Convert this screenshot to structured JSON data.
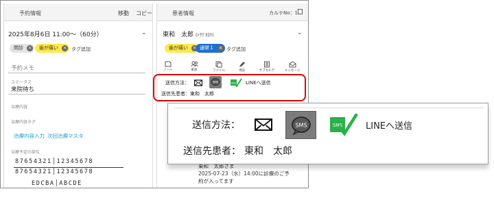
{
  "left_panel": {
    "title": "予約情報",
    "move_label": "移動",
    "copy_label": "コピー",
    "datetime": "2025年8月6日 11:00～（60分）",
    "tags": [
      "問診",
      "歯が痛い"
    ],
    "add_tag": "タグ追加",
    "memo_placeholder": "予約メモ",
    "status_label": "ステータス",
    "status_value": "来院待ち",
    "treatment_label": "治療内容",
    "treatment_tag_label": "治療内容タグ",
    "treatment_input_link": "治療内容入力",
    "next_master_link": "次回治療マスタ",
    "planned_site_label": "治療予定の部位",
    "tooth_upper": "87654321│12345678",
    "tooth_lower": "87654321│12345678",
    "tooth_letters": "EDCBA│ABCDE"
  },
  "right_panel": {
    "title": "患者情報",
    "karte_no": "カルテNo：1",
    "patient_name": "東和　太郎",
    "patient_kana": "(ﾄｳﾜ ﾀﾛｳ)",
    "tags": [
      "歯が痛い",
      "通常１"
    ],
    "add_tag": "タグ追加",
    "toolbar": [
      "ノート",
      "家族",
      "ファイル",
      "問診",
      "サブカルテ",
      "メッセージ"
    ],
    "send_method_label": "送信方法：",
    "line_send": "LINEへ送信",
    "recipient_label": "送信先患者：",
    "recipient_name": "東和　太郎",
    "message_lines": [
      "東和　太郎さま",
      "2025-07-23（水）14:00に診療のご予",
      "約が入ってます"
    ]
  },
  "zoom": {
    "send_method_label": "送信方法：",
    "sms_label": "SMS",
    "sns_label": "SNS",
    "line_send": "LINEへ送信",
    "recipient_label": "送信先患者：",
    "recipient_name": "東和　太郎"
  },
  "colors": {
    "highlight_red": "#e00000",
    "tag_yellow": "#ffe94a",
    "tag_blue": "#1f6fd0",
    "link_blue": "#1a9ecf",
    "sns_green": "#2bb14a"
  }
}
